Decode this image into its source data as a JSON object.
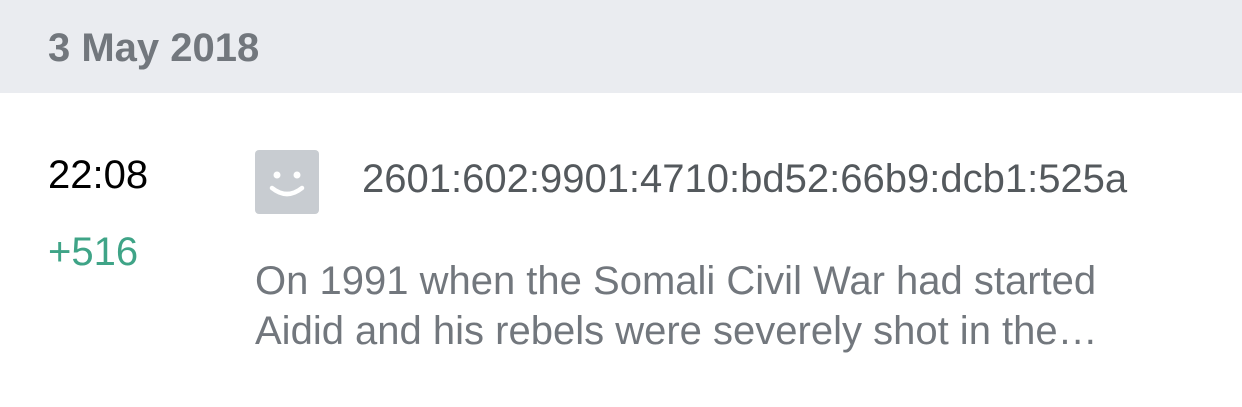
{
  "date_header": "3 May 2018",
  "entry": {
    "time": "22:08",
    "diff": "+516",
    "avatar_icon": "anonymous-user-face-icon",
    "user": "2601:602:9901:4710:bd52:66b9:dcb1:525a",
    "summary_lines": [
      "On 1991 when the Somali Civil War had started",
      "Aidid and his rebels were severely shot in the…"
    ]
  },
  "colors": {
    "header_bg": "#eaecf0",
    "diff_positive": "#3fa487",
    "avatar_bg": "#c8ccd1"
  }
}
